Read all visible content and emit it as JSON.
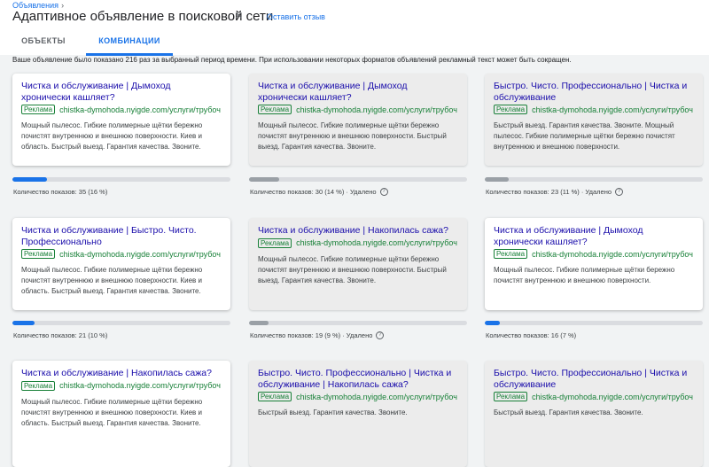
{
  "breadcrumb": {
    "label": "Объявления",
    "chevron": "›"
  },
  "header": {
    "title": "Адаптивное объявление в поисковой сети",
    "close_icon": "×",
    "feedback": "Оставить отзыв"
  },
  "tabs": [
    {
      "label": "ОБЪЕКТЫ"
    },
    {
      "label": "КОМБИНАЦИИ"
    }
  ],
  "info_text": "Ваше объявление было показано 216 раз за выбранный период времени. При использовании некоторых форматов объявлений рекламный текст может быть сокращен.",
  "ad_label": "Реклама",
  "colors": {
    "accent": "#1a73e8",
    "headline": "#1a0dab",
    "url": "#188038"
  },
  "cards": [
    {
      "headline": "Чистка и обслуживание | Дымоход хронически кашляет?",
      "url": "chistka-dymohoda.nyigde.com/услуги/трубоч…",
      "description": "Мощный пылесос. Гибкие полимерные щётки бережно почистят внутреннюю и внешнюю поверхности. Киев и область. Быстрый выезд. Гарантия качества. Звоните.",
      "stat": "Количество показов: 35 (16 %)",
      "share": 16,
      "removed": false
    },
    {
      "headline": "Чистка и обслуживание | Дымоход хронически кашляет?",
      "url": "chistka-dymohoda.nyigde.com/услуги/трубоч…",
      "description": "Мощный пылесос. Гибкие полимерные щётки бережно почистят внутреннюю и внешнюю поверхности. Быстрый выезд. Гарантия качества. Звоните.",
      "stat": "Количество показов: 30 (14 %) · Удалено",
      "share": 14,
      "removed": true
    },
    {
      "headline": "Быстро. Чисто. Профессионально | Чистка и обслуживание",
      "url": "chistka-dymohoda.nyigde.com/услуги/трубоч…",
      "description": "Быстрый выезд. Гарантия качества. Звоните. Мощный пылесос. Гибкие полимерные щётки бережно почистят внутреннюю и внешнюю поверхности.",
      "stat": "Количество показов: 23 (11 %) · Удалено",
      "share": 11,
      "removed": true
    },
    {
      "headline": "Чистка и обслуживание | Быстро. Чисто. Профессионально",
      "url": "chistka-dymohoda.nyigde.com/услуги/трубоч…",
      "description": "Мощный пылесос. Гибкие полимерные щётки бережно почистят внутреннюю и внешнюю поверхности. Киев и область. Быстрый выезд. Гарантия качества. Звоните.",
      "stat": "Количество показов: 21 (10 %)",
      "share": 10,
      "removed": false
    },
    {
      "headline": "Чистка и обслуживание | Накопилась сажа?",
      "url": "chistka-dymohoda.nyigde.com/услуги/трубоч…",
      "description": "Мощный пылесос. Гибкие полимерные щётки бережно почистят внутреннюю и внешнюю поверхности. Быстрый выезд. Гарантия качества. Звоните.",
      "stat": "Количество показов: 19 (9 %) · Удалено",
      "share": 9,
      "removed": true
    },
    {
      "headline": "Чистка и обслуживание | Дымоход хронически кашляет?",
      "url": "chistka-dymohoda.nyigde.com/услуги/трубоч…",
      "description": "Мощный пылесос. Гибкие полимерные щётки бережно почистят внутреннюю и внешнюю поверхности.",
      "stat": "Количество показов: 16 (7 %)",
      "share": 7,
      "removed": false
    },
    {
      "headline": "Чистка и обслуживание | Накопилась сажа?",
      "url": "chistka-dymohoda.nyigde.com/услуги/трубоч…",
      "description": "Мощный пылесос. Гибкие полимерные щётки бережно почистят внутреннюю и внешнюю поверхности. Киев и область. Быстрый выезд. Гарантия качества. Звоните.",
      "removed": false
    },
    {
      "headline": "Быстро. Чисто. Профессионально | Чистка и обслуживание | Накопилась сажа?",
      "url": "chistka-dymohoda.nyigde.com/услуги/трубоч…",
      "description": "Быстрый выезд. Гарантия качества. Звоните.",
      "removed": true
    },
    {
      "headline": "Быстро. Чисто. Профессионально | Чистка и обслуживание",
      "url": "chistka-dymohoda.nyigde.com/услуги/трубоч…",
      "description": "Быстрый выезд. Гарантия качества. Звоните.",
      "removed": true
    }
  ]
}
